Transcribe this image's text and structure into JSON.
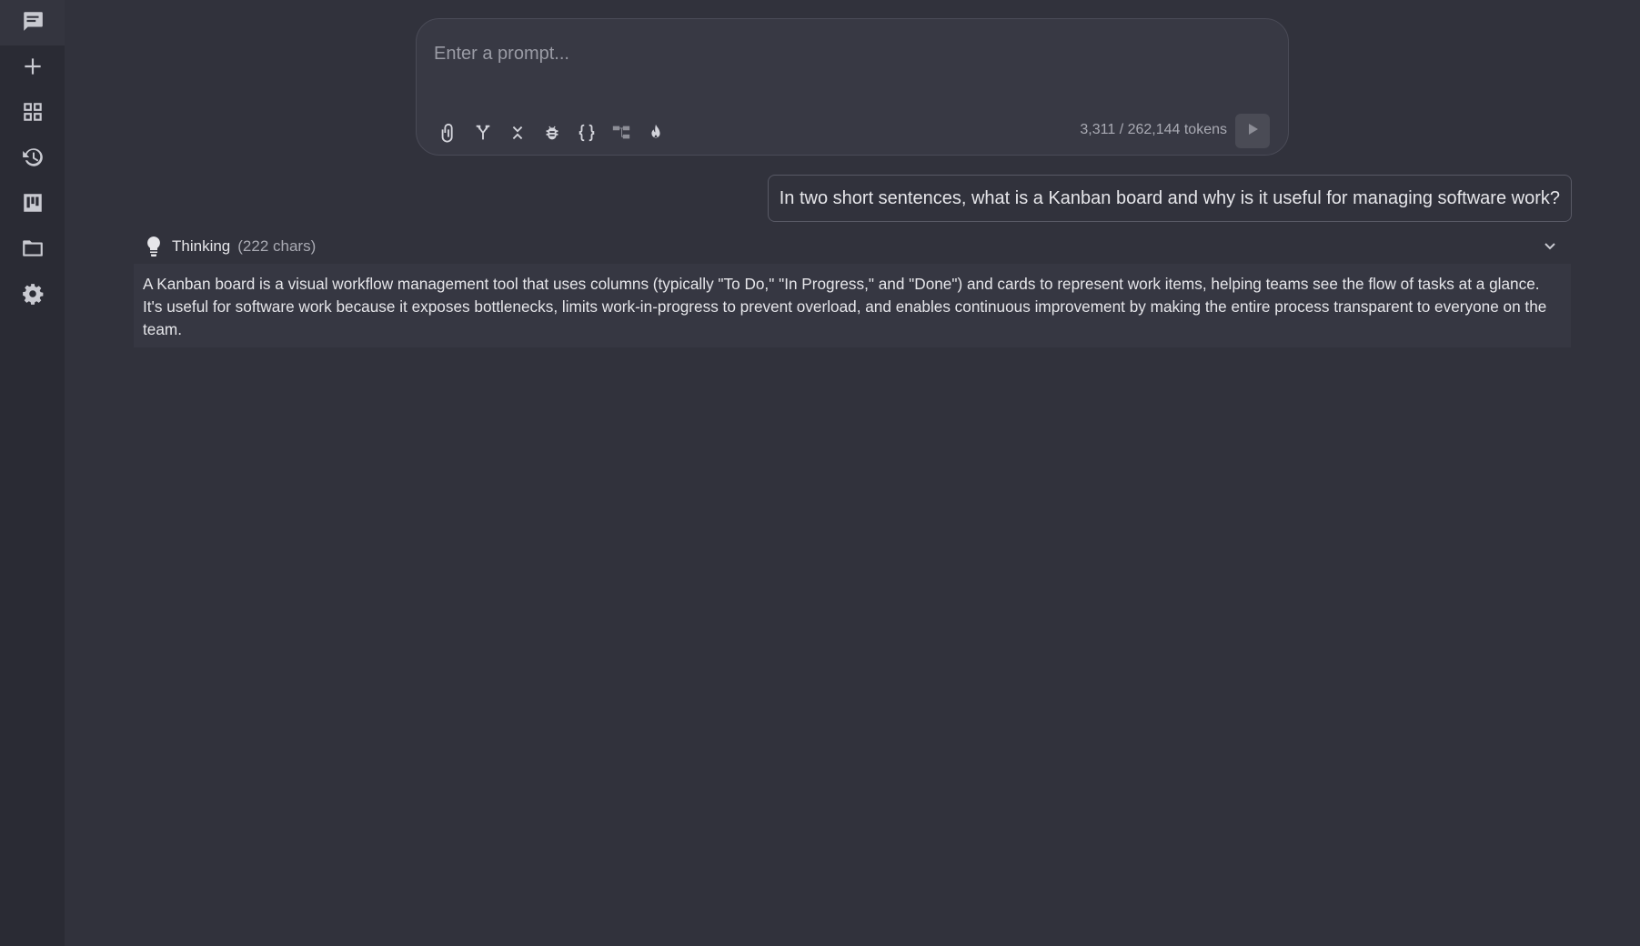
{
  "sidebar": {
    "items": [
      {
        "name": "chat",
        "icon": "chat-icon",
        "active": true
      },
      {
        "name": "new",
        "icon": "plus-icon"
      },
      {
        "name": "apps",
        "icon": "grid-icon"
      },
      {
        "name": "history",
        "icon": "history-icon"
      },
      {
        "name": "kanban",
        "icon": "kanban-icon"
      },
      {
        "name": "files",
        "icon": "folder-icon"
      },
      {
        "name": "settings",
        "icon": "gear-icon"
      }
    ]
  },
  "prompt": {
    "placeholder": "Enter a prompt...",
    "value": "",
    "tools": [
      "paperclip-icon",
      "merge-icon",
      "collapse-icon",
      "bug-icon",
      "braces-icon",
      "tree-icon",
      "flame-icon"
    ],
    "token_count": "3,311 / 262,144 tokens"
  },
  "user_message": {
    "text": "In two short sentences, what is a Kanban board and why is it useful for managing software work?"
  },
  "thinking": {
    "label": "Thinking",
    "count": "(222 chars)",
    "body": "A Kanban board is a visual workflow management tool that uses columns (typically \"To Do,\" \"In Progress,\" and \"Done\") and cards to represent work items, helping teams see the flow of tasks at a glance. It's useful for software work because it exposes bottlenecks, limits work-in-progress to prevent overload, and enables continuous improvement by making the entire process transparent to everyone on the team."
  },
  "colors": {
    "background": "#31323c",
    "sidebar": "#2a2b34",
    "text": "#e6e6ea"
  }
}
